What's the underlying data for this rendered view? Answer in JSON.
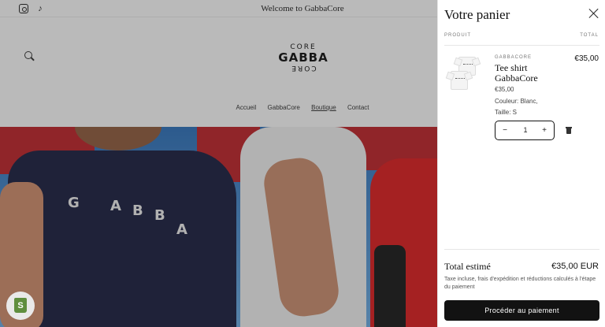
{
  "announcement": {
    "text": "Welcome to GabbaCore"
  },
  "social": {
    "instagram_icon": "instagram-icon",
    "tiktok_icon": "tiktok-icon",
    "tiktok_glyph": "♪"
  },
  "header": {
    "logo": {
      "line1": "CORE",
      "line2": "GABBA",
      "line3": "CORE"
    },
    "nav": [
      "Accueil",
      "GabbaCore",
      "Boutique",
      "Contact"
    ],
    "active_nav": "Boutique"
  },
  "hero": {
    "print_letters": [
      "G",
      "A",
      "B",
      "B",
      "A"
    ]
  },
  "cart": {
    "title": "Votre panier",
    "col_product": "PRODUIT",
    "col_total": "TOTAL",
    "item": {
      "vendor": "GABBACORE",
      "name": "Tee shirt GabbaCore",
      "unit_price": "€35,00",
      "line_price": "€35,00",
      "option_color": "Couleur: Blanc,",
      "option_size": "Taille: S",
      "quantity": "1",
      "minus": "−",
      "plus": "+"
    },
    "total_label": "Total estimé",
    "total_value": "€35,00 EUR",
    "tax_note": "Taxe incluse, frais d'expédition et réductions calculés à l'étape du paiement",
    "checkout_label": "Procéder au paiement"
  },
  "shopify_badge": {
    "glyph": "S"
  },
  "colors": {
    "accent": "#121212",
    "overlay": "rgba(40,40,40,0.28)",
    "badge_green": "#5f8e3e"
  }
}
